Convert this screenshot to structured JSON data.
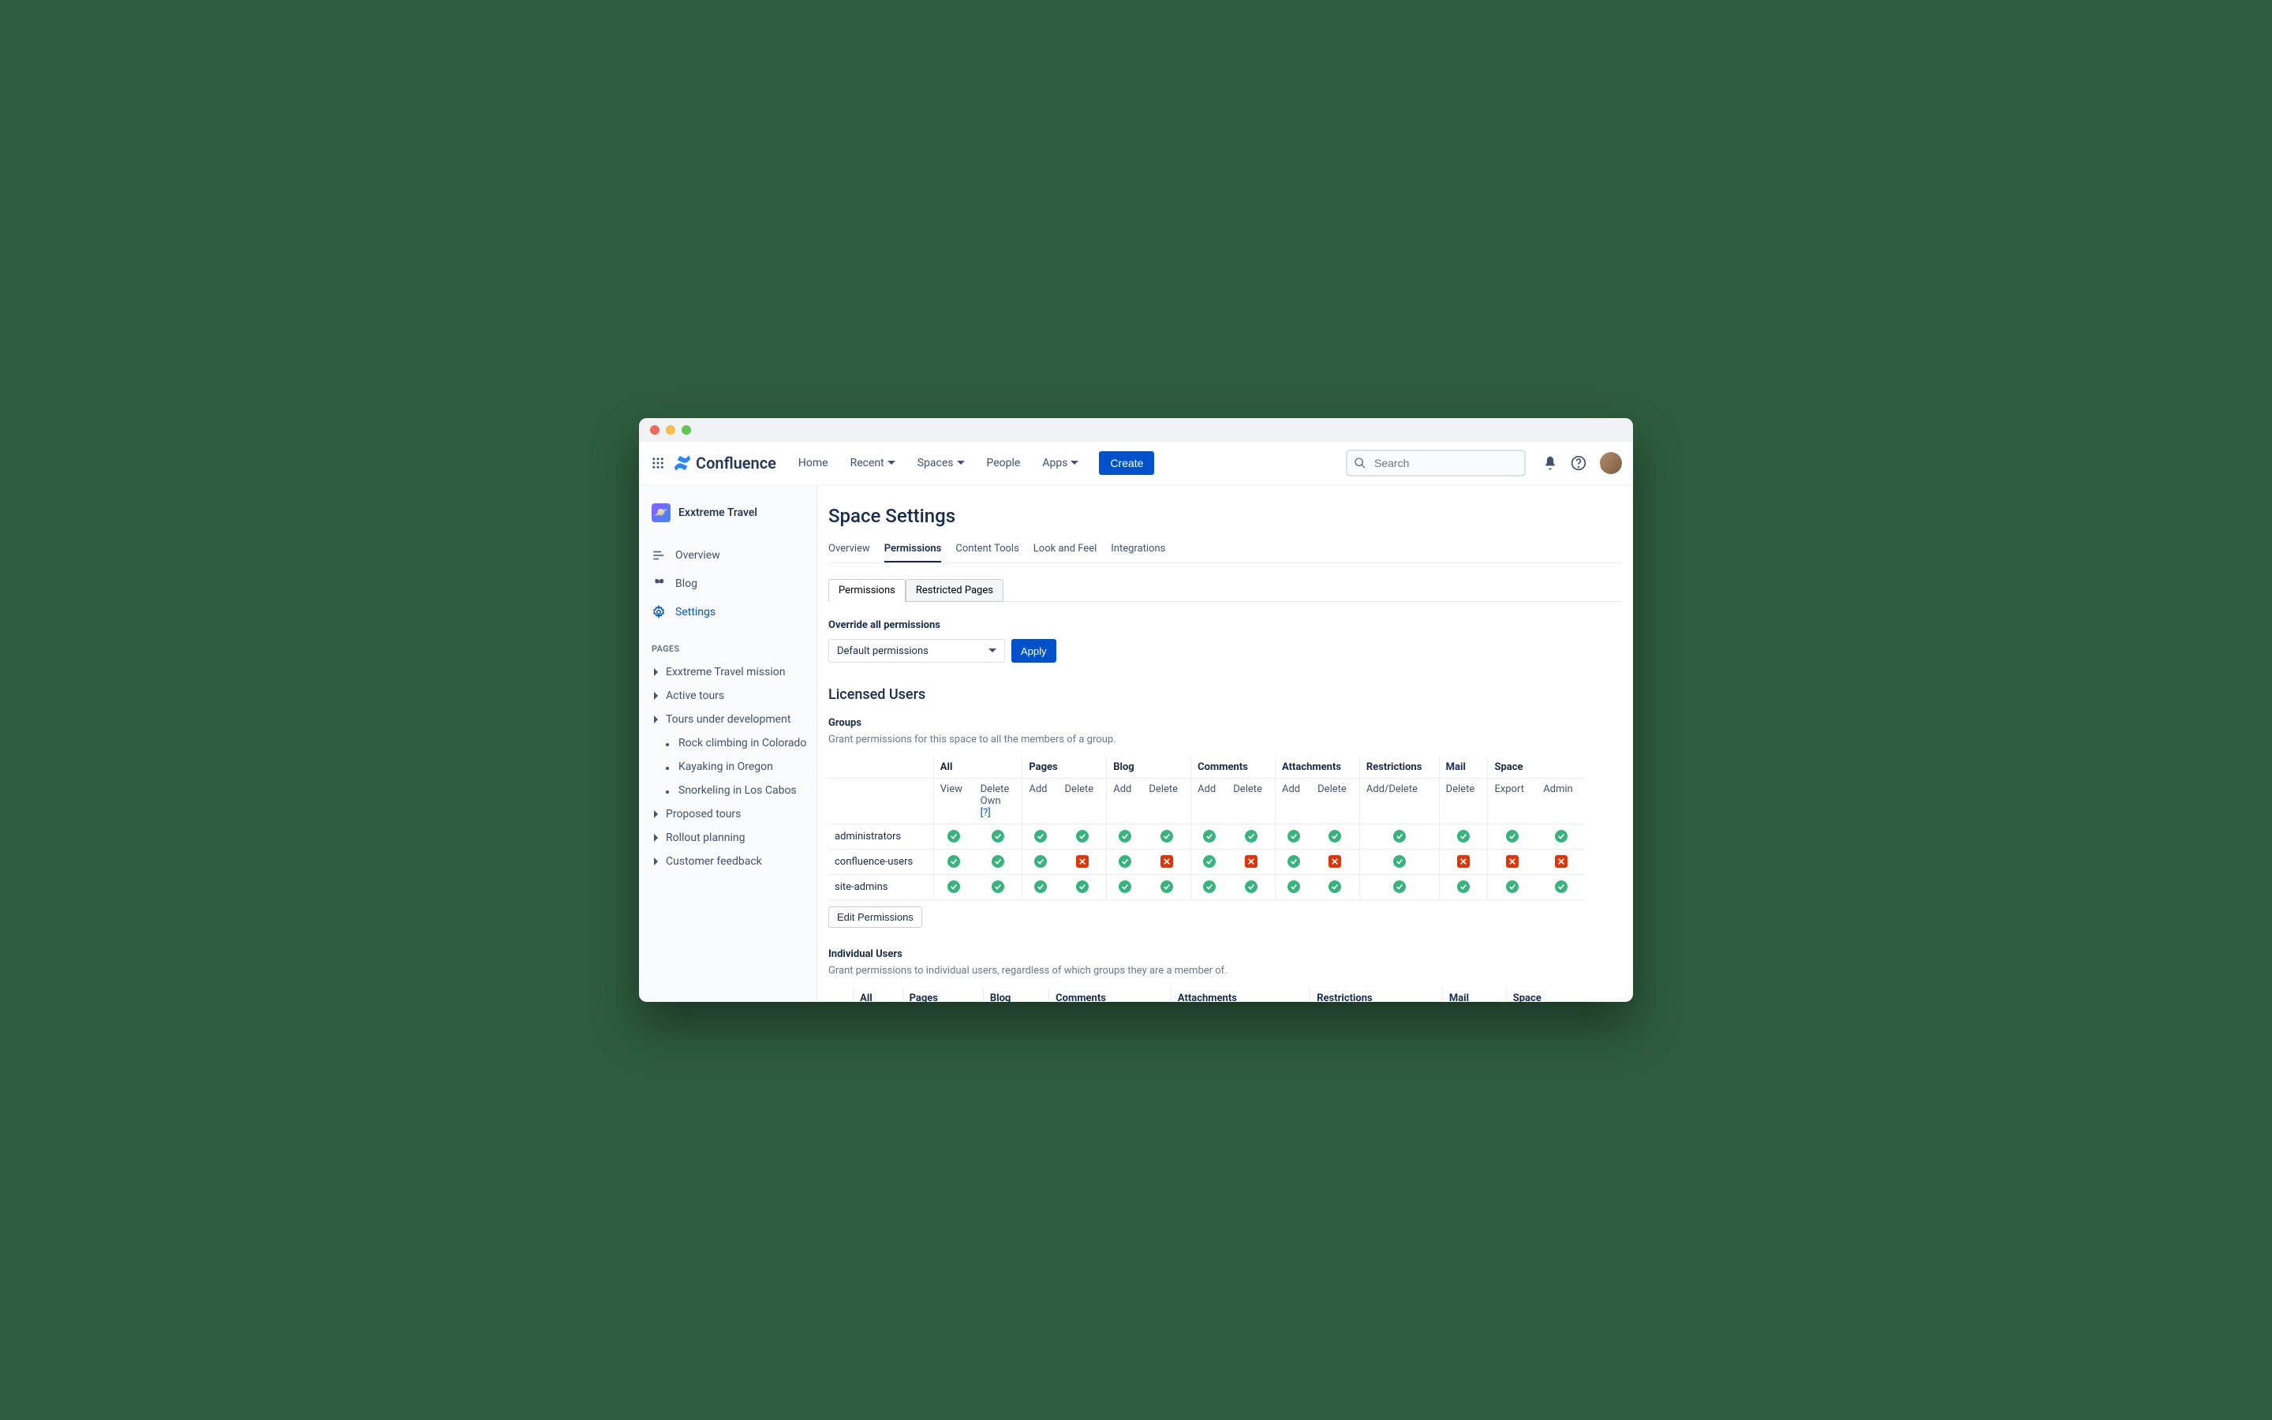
{
  "window": {
    "app_name": "Confluence"
  },
  "topnav": {
    "items": [
      "Home",
      "Recent",
      "Spaces",
      "People",
      "Apps"
    ],
    "create": "Create",
    "search_placeholder": "Search"
  },
  "sidebar": {
    "space_name": "Exxtreme Travel",
    "nav": [
      {
        "label": "Overview"
      },
      {
        "label": "Blog"
      },
      {
        "label": "Settings"
      }
    ],
    "pages_heading": "PAGES",
    "tree": [
      {
        "label": "Exxtreme Travel mission",
        "children": []
      },
      {
        "label": "Active tours",
        "children": []
      },
      {
        "label": "Tours under development",
        "children": [
          "Rock climbing in Colorado",
          "Kayaking in Oregon",
          "Snorkeling in Los Cabos"
        ]
      },
      {
        "label": "Proposed tours",
        "children": []
      },
      {
        "label": "Rollout planning",
        "children": []
      },
      {
        "label": "Customer feedback",
        "children": []
      }
    ]
  },
  "page": {
    "title": "Space Settings",
    "tabs": [
      "Overview",
      "Permissions",
      "Content Tools",
      "Look and Feel",
      "Integrations"
    ],
    "active_tab": 1,
    "subtabs": [
      "Permissions",
      "Restricted Pages"
    ],
    "active_subtab": 0,
    "override": {
      "title": "Override all permissions",
      "select_value": "Default permissions",
      "apply": "Apply"
    },
    "licensed_heading": "Licensed Users",
    "groups": {
      "title": "Groups",
      "help": "Grant permissions for this space to all the members of a group.",
      "column_groups": [
        "All",
        "Pages",
        "Blog",
        "Comments",
        "Attachments",
        "Restrictions",
        "Mail",
        "Space"
      ],
      "sub_headers": {
        "All": [
          "View",
          "Delete Own"
        ],
        "Pages": [
          "Add",
          "Delete"
        ],
        "Blog": [
          "Add",
          "Delete"
        ],
        "Comments": [
          "Add",
          "Delete"
        ],
        "Attachments": [
          "Add",
          "Delete"
        ],
        "Restrictions": [
          "Add/Delete"
        ],
        "Mail": [
          "Delete"
        ],
        "Space": [
          "Export",
          "Admin"
        ]
      },
      "help_marker": "[?]",
      "rows": [
        {
          "name": "administrators",
          "perms": [
            true,
            true,
            true,
            true,
            true,
            true,
            true,
            true,
            true,
            true,
            true,
            true,
            true,
            true
          ]
        },
        {
          "name": "confluence-users",
          "perms": [
            true,
            true,
            true,
            false,
            true,
            false,
            true,
            false,
            true,
            false,
            true,
            false,
            false,
            false
          ]
        },
        {
          "name": "site-admins",
          "perms": [
            true,
            true,
            true,
            true,
            true,
            true,
            true,
            true,
            true,
            true,
            true,
            true,
            true,
            true
          ]
        }
      ],
      "edit_button": "Edit Permissions"
    },
    "individual": {
      "title": "Individual Users",
      "help": "Grant permissions to individual users, regardless of which groups they are a member of.",
      "column_groups": [
        "All",
        "Pages",
        "Blog",
        "Comments",
        "Attachments",
        "Restrictions",
        "Mail",
        "Space"
      ]
    }
  }
}
